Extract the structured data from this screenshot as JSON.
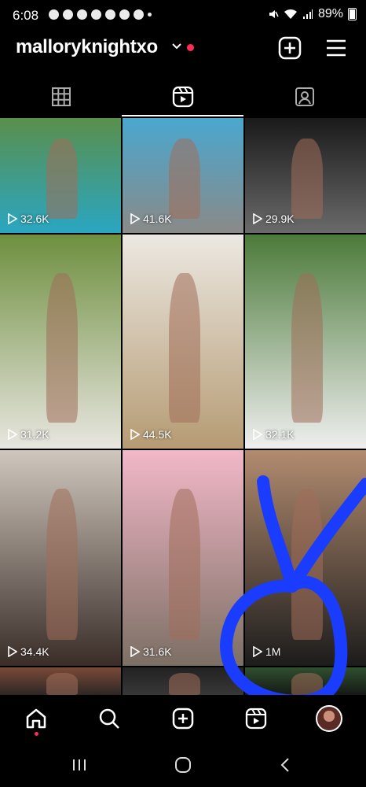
{
  "status_bar": {
    "time": "6:08",
    "battery": "89%",
    "notification_icons": [
      "snapchat-icon",
      "snapchat-icon",
      "snapchat-icon",
      "messenger-icon",
      "telegram-icon",
      "instagram-icon",
      "tiktok-icon",
      "more-dot-icon"
    ],
    "system_icons": [
      "mute-icon",
      "wifi-icon",
      "signal-icon",
      "battery-icon"
    ]
  },
  "header": {
    "username": "malloryknightxo",
    "has_unread_dot": true,
    "create_icon": "plus-square-icon",
    "menu_icon": "hamburger-menu-icon"
  },
  "tabs": [
    {
      "icon": "grid-icon",
      "active": false
    },
    {
      "icon": "reels-icon",
      "active": true
    },
    {
      "icon": "tagged-icon",
      "active": false
    }
  ],
  "reels": [
    {
      "views": "32.6K",
      "colors": [
        "#5a8f4c",
        "#2aa6c2"
      ]
    },
    {
      "views": "41.6K",
      "colors": [
        "#4aa7cf",
        "#8a8a88"
      ]
    },
    {
      "views": "29.9K",
      "colors": [
        "#1a1a1a",
        "#6a6a6a"
      ]
    },
    {
      "views": "31.2K",
      "colors": [
        "#6e8f3f",
        "#e8e6e0"
      ]
    },
    {
      "views": "44.5K",
      "colors": [
        "#ece8e2",
        "#b59b73"
      ]
    },
    {
      "views": "32.1K",
      "colors": [
        "#4c7a3a",
        "#efefef"
      ]
    },
    {
      "views": "34.4K",
      "colors": [
        "#cfc7bd",
        "#3a2d28"
      ]
    },
    {
      "views": "31.6K",
      "colors": [
        "#f2b8c8",
        "#7c6f64"
      ]
    },
    {
      "views": "1M",
      "colors": [
        "#b28b6f",
        "#1c1c1c"
      ]
    },
    {
      "views": "",
      "colors": [
        "#7a4a38",
        "#222"
      ]
    },
    {
      "views": "",
      "colors": [
        "#222",
        "#3a3a3a"
      ]
    },
    {
      "views": "",
      "colors": [
        "#2f4f2f",
        "#111"
      ]
    }
  ],
  "bottom_nav": [
    {
      "icon": "home-icon"
    },
    {
      "icon": "search-icon"
    },
    {
      "icon": "create-icon"
    },
    {
      "icon": "reels-icon"
    },
    {
      "icon": "profile-avatar"
    }
  ],
  "system_nav": [
    {
      "icon": "recent-apps-icon"
    },
    {
      "icon": "home-circle-icon"
    },
    {
      "icon": "back-icon"
    }
  ],
  "annotation": {
    "color": "#1a3cff"
  }
}
